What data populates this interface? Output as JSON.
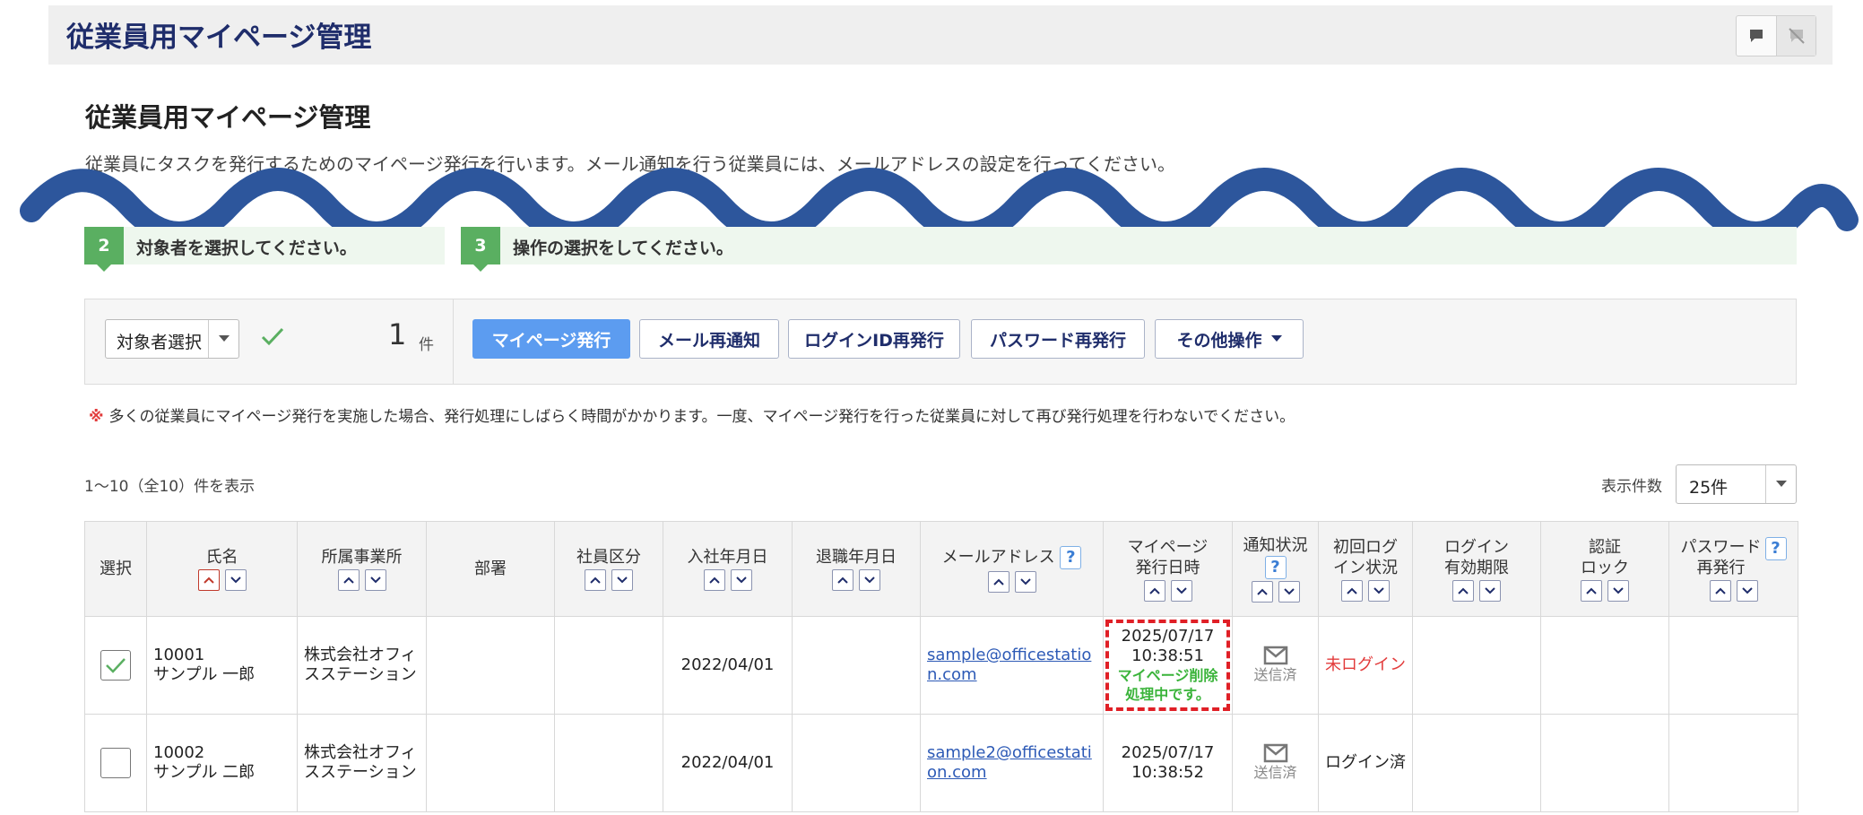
{
  "header": {
    "title": "従業員用マイページ管理"
  },
  "heading": "従業員用マイページ管理",
  "description": "従業員にタスクを発行するためのマイページ発行を行います。メール通知を行う従業員には、メールアドレスの設定を行ってください。",
  "steps": [
    {
      "num": "2",
      "label": "対象者を選択してください。"
    },
    {
      "num": "3",
      "label": "操作の選択をしてください。"
    }
  ],
  "operation": {
    "select_label": "対象者選択",
    "count": "1",
    "count_unit": "件",
    "buttons": {
      "issue": "マイページ発行",
      "resend": "メール再通知",
      "login_id": "ログインID再発行",
      "password": "パスワード再発行",
      "other": "その他操作"
    }
  },
  "note": {
    "mark": "※",
    "text": "多くの従業員にマイページ発行を実施した場合、発行処理にしばらく時間がかかります。一度、マイページ発行を行った従業員に対して再び発行処理を行わないでください。"
  },
  "range_text": "1〜10（全10）件を表示",
  "per_page": {
    "label": "表示件数",
    "value": "25件"
  },
  "table": {
    "headers": {
      "select": "選択",
      "name": "氏名",
      "office": "所属事業所",
      "dept": "部署",
      "type": "社員区分",
      "join": "入社年月日",
      "leave": "退職年月日",
      "email": "メールアドレス",
      "issued_1": "マイページ",
      "issued_2": "発行日時",
      "notify": "通知状況",
      "login_1": "初回ログ",
      "login_2": "イン状況",
      "expire_1": "ログイン",
      "expire_2": "有効期限",
      "lock_1": "認証",
      "lock_2": "ロック",
      "pwre_1": "パスワード",
      "pwre_2": "再発行",
      "help": "?"
    },
    "rows": [
      {
        "checked": true,
        "id": "10001",
        "name": "サンプル 一郎",
        "office": "株式会社オフィスステーション",
        "join": "2022/04/01",
        "email": "sample@officestation.com",
        "issued_date": "2025/07/17",
        "issued_time": "10:38:51",
        "status_note": "マイページ削除処理中です。",
        "notify": "送信済",
        "login_status": "未ログイン"
      },
      {
        "checked": false,
        "id": "10002",
        "name": "サンプル 二郎",
        "office": "株式会社オフィスステーション",
        "join": "2022/04/01",
        "email": "sample2@officestation.com",
        "issued_date": "2025/07/17",
        "issued_time": "10:38:52",
        "status_note": "",
        "notify": "送信済",
        "login_status": "ログイン済"
      }
    ]
  }
}
